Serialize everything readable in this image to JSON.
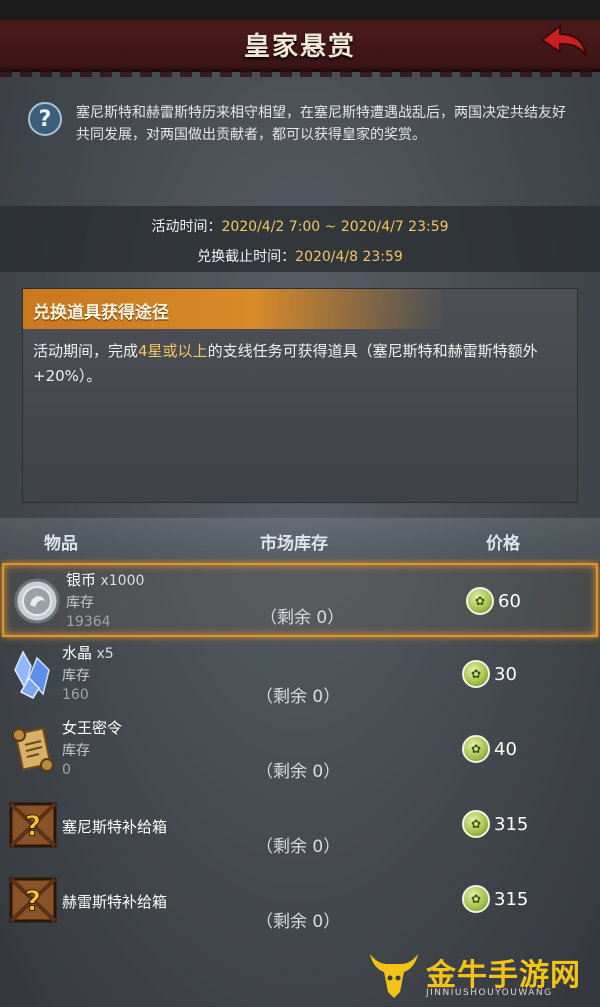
{
  "header": {
    "title": "皇家悬赏"
  },
  "info": {
    "text": "塞尼斯特和赫雷斯特历来相守相望，在塞尼斯特遭遇战乱后，两国决定共结友好共同发展，对两国做出贡献者，都可以获得皇家的奖赏。"
  },
  "times": {
    "activity_label": "活动时间：",
    "activity_value": "2020/4/2 7:00 ~ 2020/4/7 23:59",
    "exchange_label": "兑换截止时间：",
    "exchange_value": "2020/4/8 23:59"
  },
  "obtain": {
    "title": "兑换道具获得途径",
    "text_before": "活动期间，完成",
    "text_highlight": "4星或以上",
    "text_after": "的支线任务可获得道具（塞尼斯特和赫雷斯特额外+20%）。"
  },
  "table": {
    "col_item": "物品",
    "col_stock": "市场库存",
    "col_price": "价格",
    "rows": [
      {
        "name": "银币",
        "qty": " x1000",
        "stock_label": "库存",
        "stock_value": "19364",
        "remaining": "（剩余 0）",
        "price": "60",
        "icon": "silver-coin-icon"
      },
      {
        "name": "水晶",
        "qty": " x5",
        "stock_label": "库存",
        "stock_value": "160",
        "remaining": "（剩余 0）",
        "price": "30",
        "icon": "crystal-icon"
      },
      {
        "name": "女王密令",
        "qty": "",
        "stock_label": "库存",
        "stock_value": "0",
        "remaining": "（剩余 0）",
        "price": "40",
        "icon": "scroll-icon"
      },
      {
        "name": "塞尼斯特补给箱",
        "qty": "",
        "stock_label": "",
        "stock_value": "",
        "remaining": "（剩余 0）",
        "price": "315",
        "icon": "mystery-box-icon"
      },
      {
        "name": "赫雷斯特补给箱",
        "qty": "",
        "stock_label": "",
        "stock_value": "",
        "remaining": "（剩余 0）",
        "price": "315",
        "icon": "mystery-box-icon"
      }
    ]
  },
  "watermark": {
    "text": "金牛手游网",
    "sub": "JINNIUSHOUYOUWANG"
  },
  "colors": {
    "accent_orange": "#e2922a",
    "highlight_yellow": "#f3c65e",
    "header_red": "#4a1a1c"
  }
}
